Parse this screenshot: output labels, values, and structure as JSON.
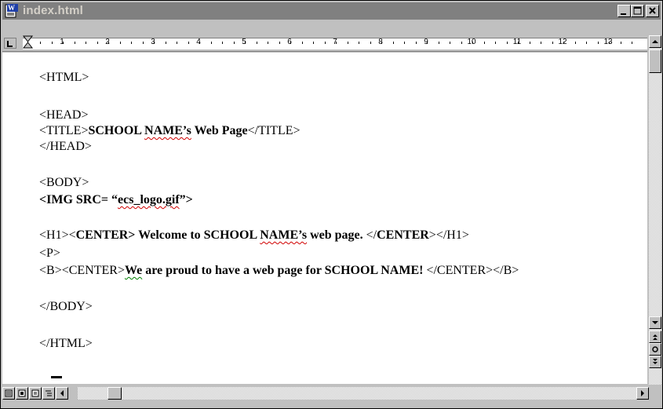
{
  "window": {
    "title": "index.html"
  },
  "ruler": {
    "numbers": [
      "1",
      "2",
      "3",
      "4",
      "5",
      "6",
      "7",
      "8",
      "9",
      "10",
      "11",
      "12",
      "13"
    ]
  },
  "document": {
    "l1": "<HTML>",
    "l3": "<HEAD>",
    "l4a": "<TITLE>",
    "l4b": "SCHOOL ",
    "l4c": "NAME’s",
    "l4d": " Web Page",
    "l4e": "</TITLE>",
    "l5": "</HEAD>",
    "l7": "<BODY>",
    "l8a": "<IMG SRC= “",
    "l8b": "ecs_logo.gif",
    "l8c": "”>",
    "l10a": "<H1><",
    "l10b": "CENTER> Welcome to SCHOOL ",
    "l10c": "NAME’s",
    "l10d": " web page. ",
    "l10e": "</",
    "l10f": "CENTER",
    "l10g": "></H1>",
    "l11": "<P>",
    "l12a": "<B><CENTER>",
    "l12b": "We",
    "l12c": " are proud to have a web page for SCHOOL NAME! ",
    "l12d": "</CENTER></B>",
    "l14": "</BODY>",
    "l16": "</HTML>"
  },
  "colors": {
    "titlebar": "#808080",
    "spelling": "#d00000",
    "grammar": "#008000"
  },
  "icons": [
    "word-document-icon",
    "minimize-icon",
    "maximize-icon",
    "close-icon",
    "tab-stop-icon",
    "scroll-up-icon",
    "scroll-down-icon",
    "previous-page-icon",
    "browse-object-icon",
    "next-page-icon",
    "scroll-left-icon",
    "scroll-right-icon",
    "normal-view-icon",
    "online-layout-icon",
    "page-layout-icon",
    "outline-view-icon"
  ]
}
